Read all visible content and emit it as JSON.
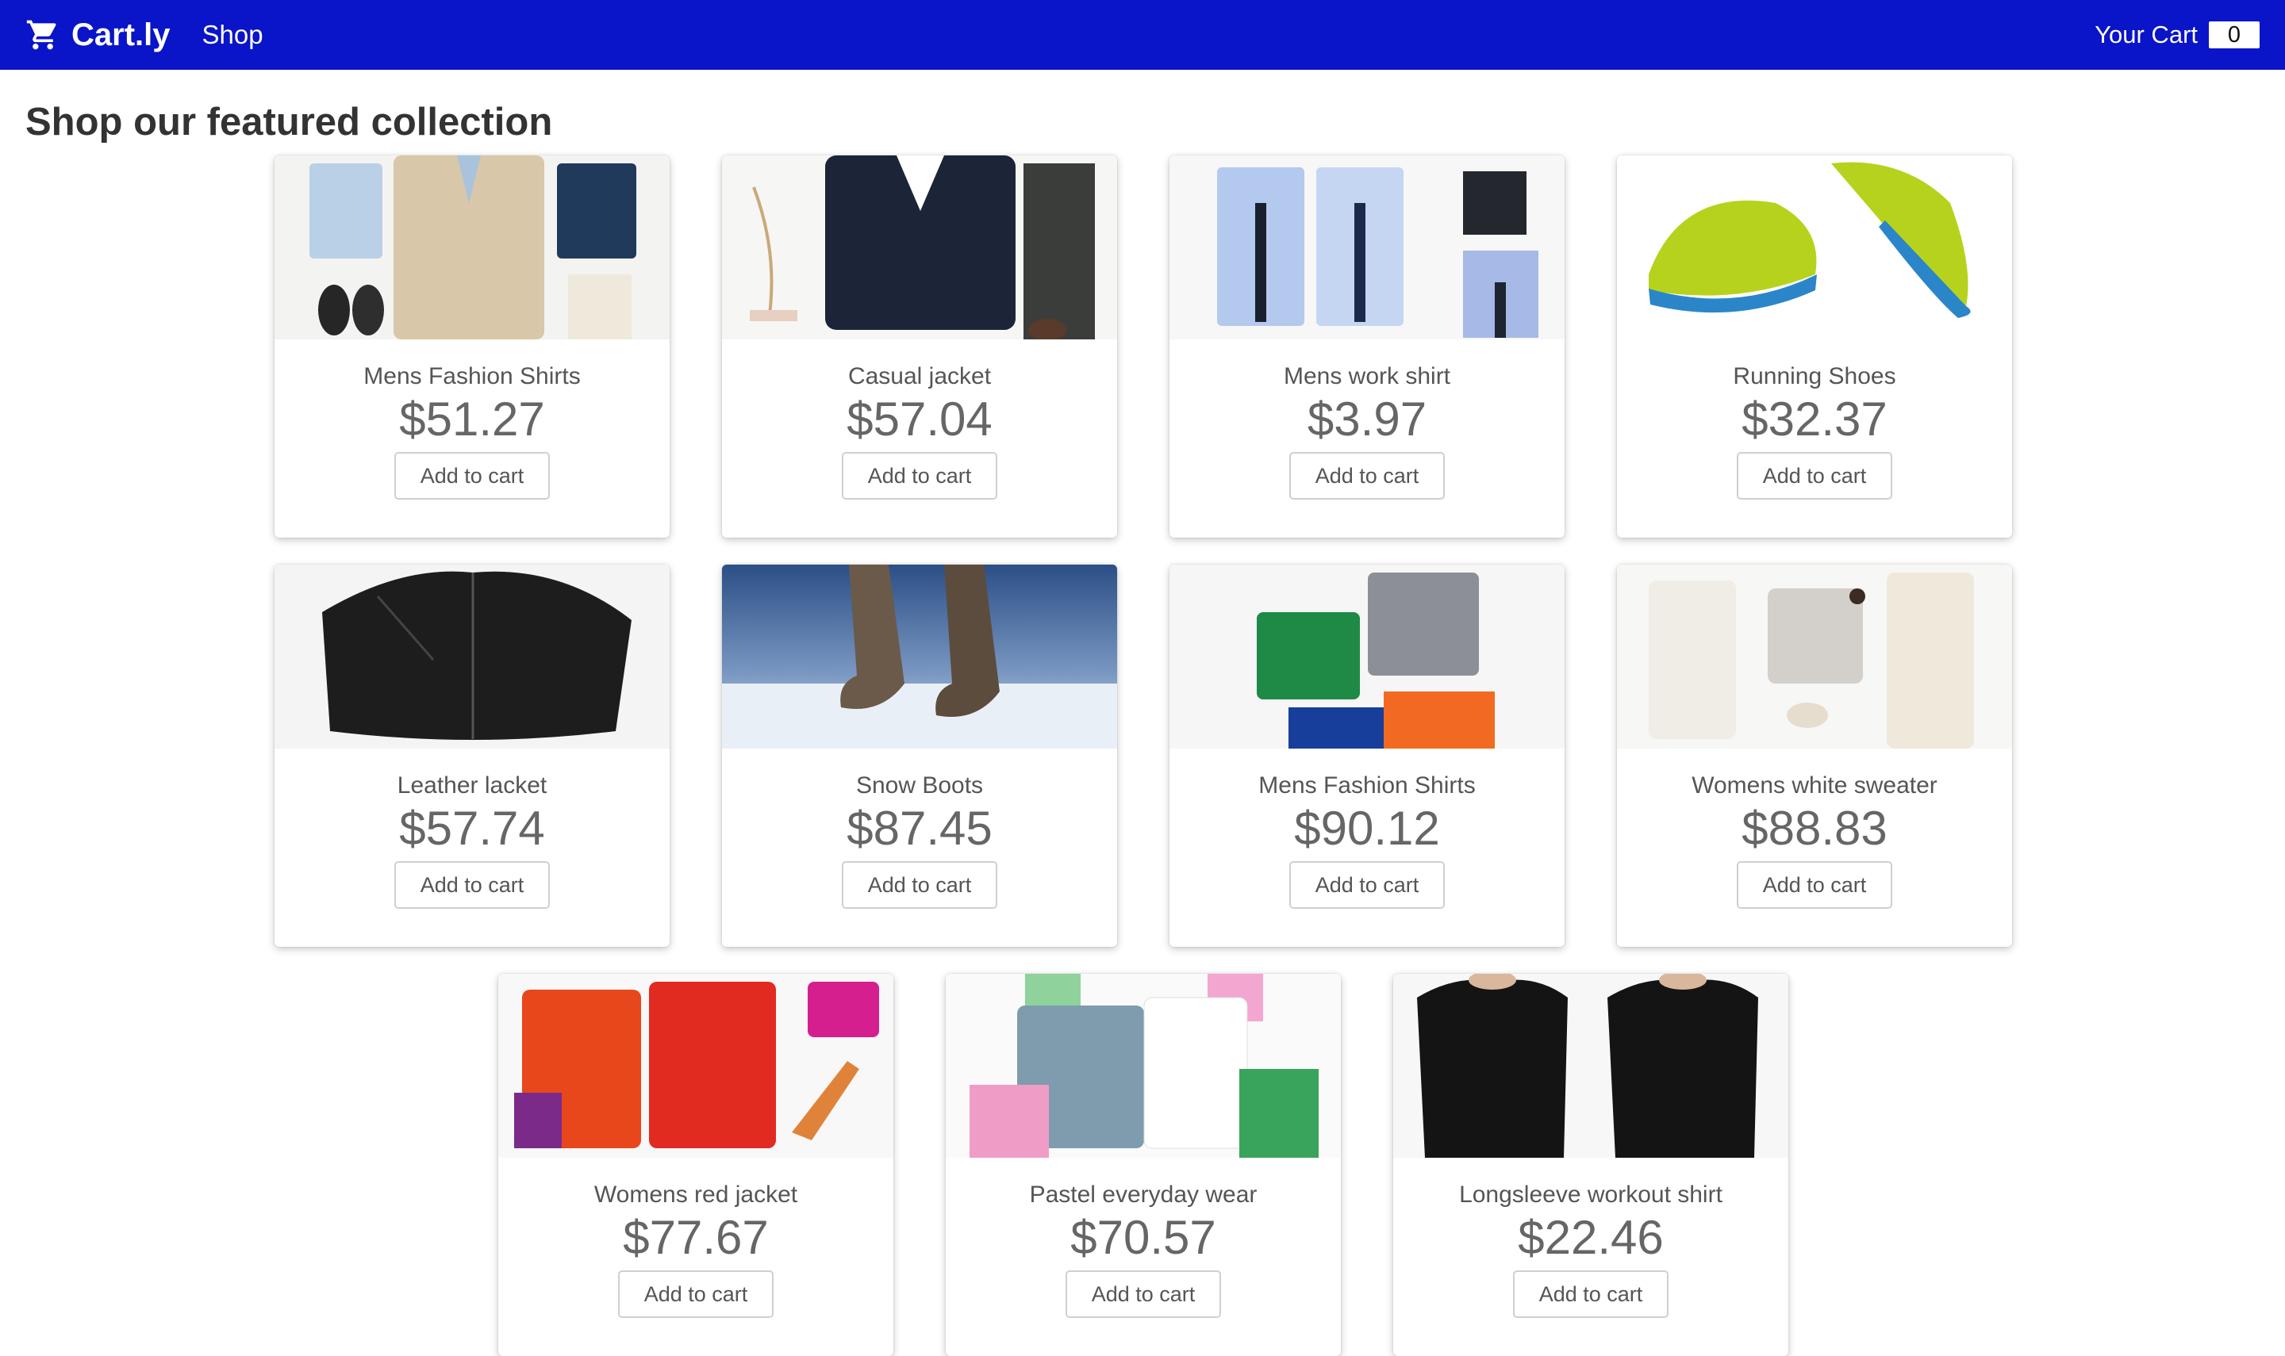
{
  "header": {
    "brand": "Cart.ly",
    "nav_shop": "Shop",
    "cart_label": "Your Cart",
    "cart_count": "0",
    "bar_color": "#0a14c8"
  },
  "page": {
    "title": "Shop our featured collection"
  },
  "products": [
    {
      "name": "Mens Fashion Shirts",
      "price": "$51.27",
      "button": "Add to cart",
      "image": "mens-outfit-flatlay"
    },
    {
      "name": "Casual jacket",
      "price": "$57.04",
      "button": "Add to cart",
      "image": "navy-jacket-flatlay"
    },
    {
      "name": "Mens work shirt",
      "price": "$3.97",
      "button": "Add to cart",
      "image": "blue-dress-shirts-ties"
    },
    {
      "name": "Running Shoes",
      "price": "$32.37",
      "button": "Add to cart",
      "image": "lime-running-shoes"
    },
    {
      "name": "Leather lacket",
      "price": "$57.74",
      "button": "Add to cart",
      "image": "black-leather-jacket"
    },
    {
      "name": "Snow Boots",
      "price": "$87.45",
      "button": "Add to cart",
      "image": "boots-in-snow"
    },
    {
      "name": "Mens Fashion Shirts",
      "price": "$90.12",
      "button": "Add to cart",
      "image": "polo-shirts-stack"
    },
    {
      "name": "Womens white sweater",
      "price": "$88.83",
      "button": "Add to cart",
      "image": "white-sweater-outfit"
    },
    {
      "name": "Womens red jacket",
      "price": "$77.67",
      "button": "Add to cart",
      "image": "red-jacket-heels"
    },
    {
      "name": "Pastel everyday wear",
      "price": "$70.57",
      "button": "Add to cart",
      "image": "pastel-shirts-flatlay"
    },
    {
      "name": "Longsleeve workout shirt",
      "price": "$22.46",
      "button": "Add to cart",
      "image": "black-longsleeve-shirts"
    }
  ]
}
